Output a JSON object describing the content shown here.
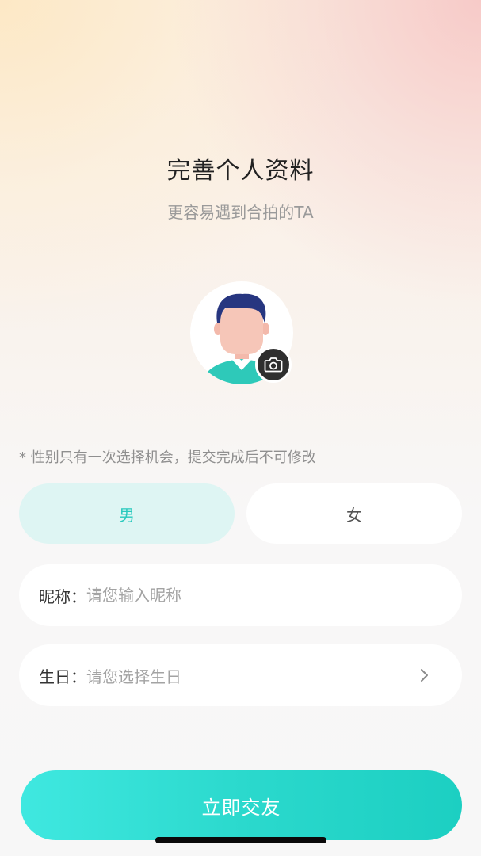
{
  "header": {
    "title": "完善个人资料",
    "subtitle": "更容易遇到合拍的TA"
  },
  "avatar": {
    "icon": "default-male-avatar-icon",
    "camera_icon": "camera-icon"
  },
  "gender": {
    "note": "* 性别只有一次选择机会，提交完成后不可修改",
    "options": [
      "男",
      "女"
    ],
    "selected": "男"
  },
  "form": {
    "nickname_label": "昵称：",
    "nickname_placeholder": "请您输入昵称",
    "birthday_label": "生日：",
    "birthday_placeholder": "请您选择生日"
  },
  "submit_label": "立即交友",
  "colors": {
    "accent": "#2bd9cd",
    "selected_bg": "#def5f3"
  }
}
